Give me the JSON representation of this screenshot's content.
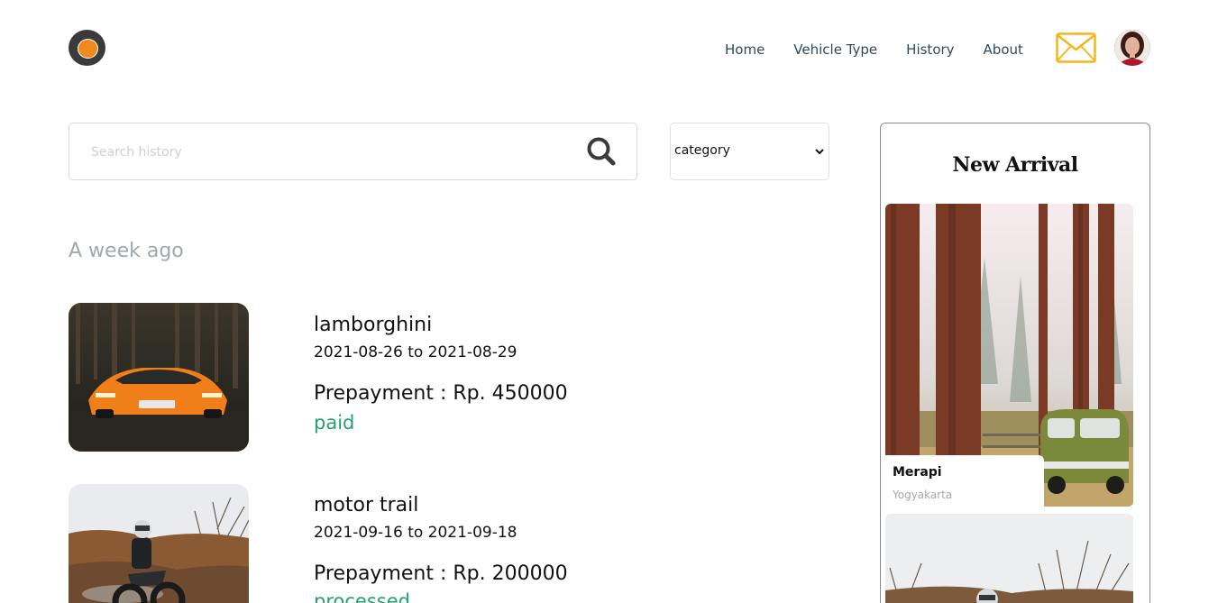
{
  "header": {
    "logo": "logo-icon",
    "nav": [
      {
        "label": "Home"
      },
      {
        "label": "Vehicle Type"
      },
      {
        "label": "History"
      },
      {
        "label": "About"
      }
    ],
    "mail_icon": "mail-icon",
    "mail_color": "#f5b51c",
    "avatar": "user-avatar"
  },
  "search": {
    "placeholder": "Search history",
    "value": "",
    "icon": "search-icon"
  },
  "filter": {
    "selected": "category"
  },
  "history": {
    "section_title": "A week ago",
    "items": [
      {
        "name": "lamborghini",
        "dates": "2021-08-26 to 2021-08-29",
        "prepayment": "Prepayment : Rp. 450000",
        "status": "paid",
        "status_color": "#24a070"
      },
      {
        "name": "motor trail",
        "dates": "2021-09-16 to 2021-09-18",
        "prepayment": "Prepayment : Rp. 200000",
        "status": "processed",
        "status_color": "#24a070"
      }
    ]
  },
  "new_arrival": {
    "title": "New Arrival",
    "items": [
      {
        "name": "Merapi",
        "location": "Yogyakarta"
      }
    ]
  }
}
